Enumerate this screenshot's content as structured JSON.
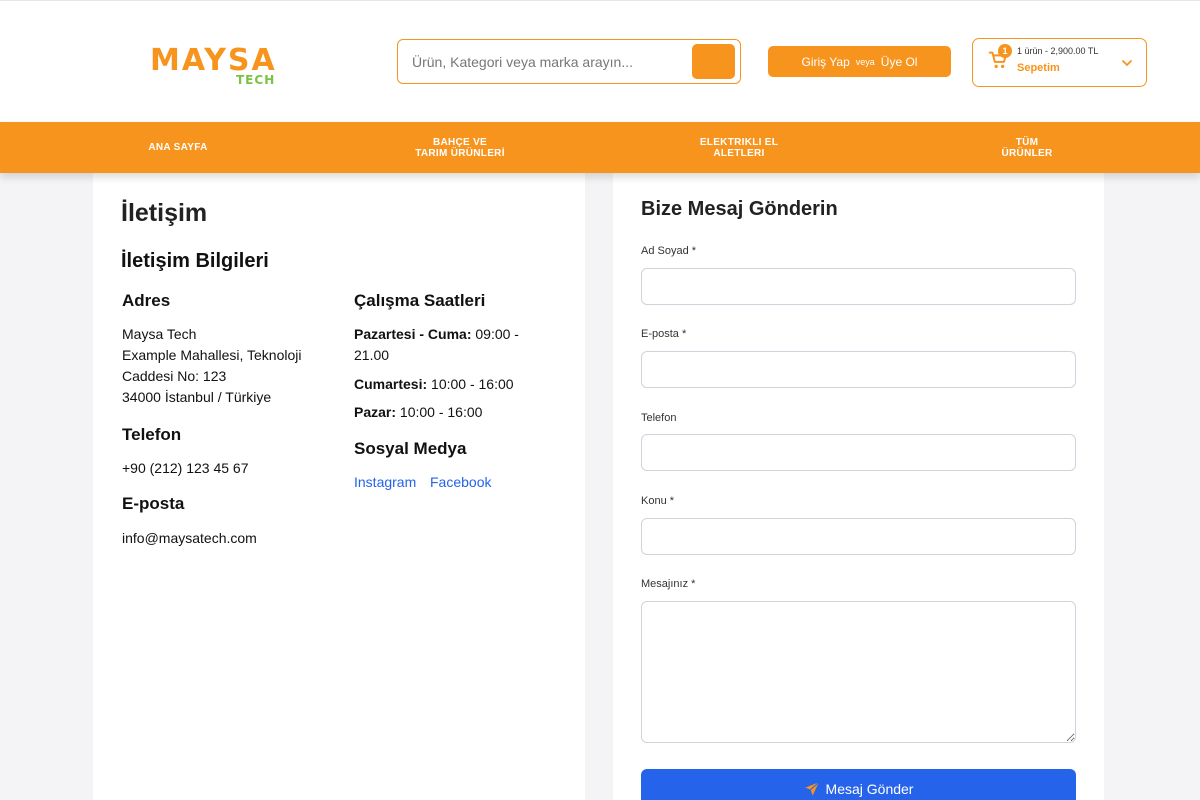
{
  "header": {
    "logo": {
      "text_main": "MAYSA",
      "text_sub": "TECH"
    },
    "search": {
      "placeholder": "Ürün, Kategori veya marka arayın..."
    },
    "auth": {
      "login": "Giriş Yap",
      "or": "veya",
      "register": "Üye Ol"
    },
    "cart": {
      "count": "1",
      "summary": "1 ürün - 2,900.00 TL",
      "label": "Sepetim"
    }
  },
  "nav": {
    "items": [
      {
        "label": "ANA SAYFA"
      },
      {
        "label": "BAHÇE VE\nTARIM ÜRÜNLERİ"
      },
      {
        "label": "ELEKTRIKLI EL\nALETLERI"
      },
      {
        "label": "TÜM\nÜRÜNLER"
      }
    ]
  },
  "contact": {
    "page_title": "İletişim",
    "info_title": "İletişim Bilgileri",
    "address": {
      "heading": "Adres",
      "lines": [
        "Maysa Tech",
        "Example Mahallesi, Teknoloji",
        "Caddesi No: 123",
        "34000 İstanbul / Türkiye"
      ]
    },
    "phone": {
      "heading": "Telefon",
      "value": "+90 (212) 123 45 67"
    },
    "email": {
      "heading": "E-posta",
      "value": "info@maysatech.com"
    },
    "hours": {
      "heading": "Çalışma Saatleri",
      "weekdays_label": "Pazartesi - Cuma:",
      "weekdays_value": "09:00 - 21.00",
      "saturday_label": "Cumartesi:",
      "saturday_value": "10:00 - 16:00",
      "sunday_label": "Pazar:",
      "sunday_value": "10:00 - 16:00"
    },
    "social": {
      "heading": "Sosyal Medya",
      "instagram": "Instagram",
      "facebook": "Facebook"
    }
  },
  "form": {
    "title": "Bize Mesaj Gönderin",
    "name_label": "Ad Soyad *",
    "name_value": "",
    "email_label": "E-posta *",
    "email_value": "",
    "phone_label": "Telefon",
    "phone_value": "",
    "subject_label": "Konu *",
    "subject_value": "",
    "message_label": "Mesajınız *",
    "message_value": "",
    "submit": "Mesaj Gönder"
  },
  "colors": {
    "brand": "#f7941d",
    "accent_green": "#7cc242",
    "link": "#2563eb"
  },
  "icons": {
    "search": "search-icon",
    "cart": "cart-icon",
    "chevron": "chevron-down-icon",
    "send": "paper-plane-icon"
  }
}
